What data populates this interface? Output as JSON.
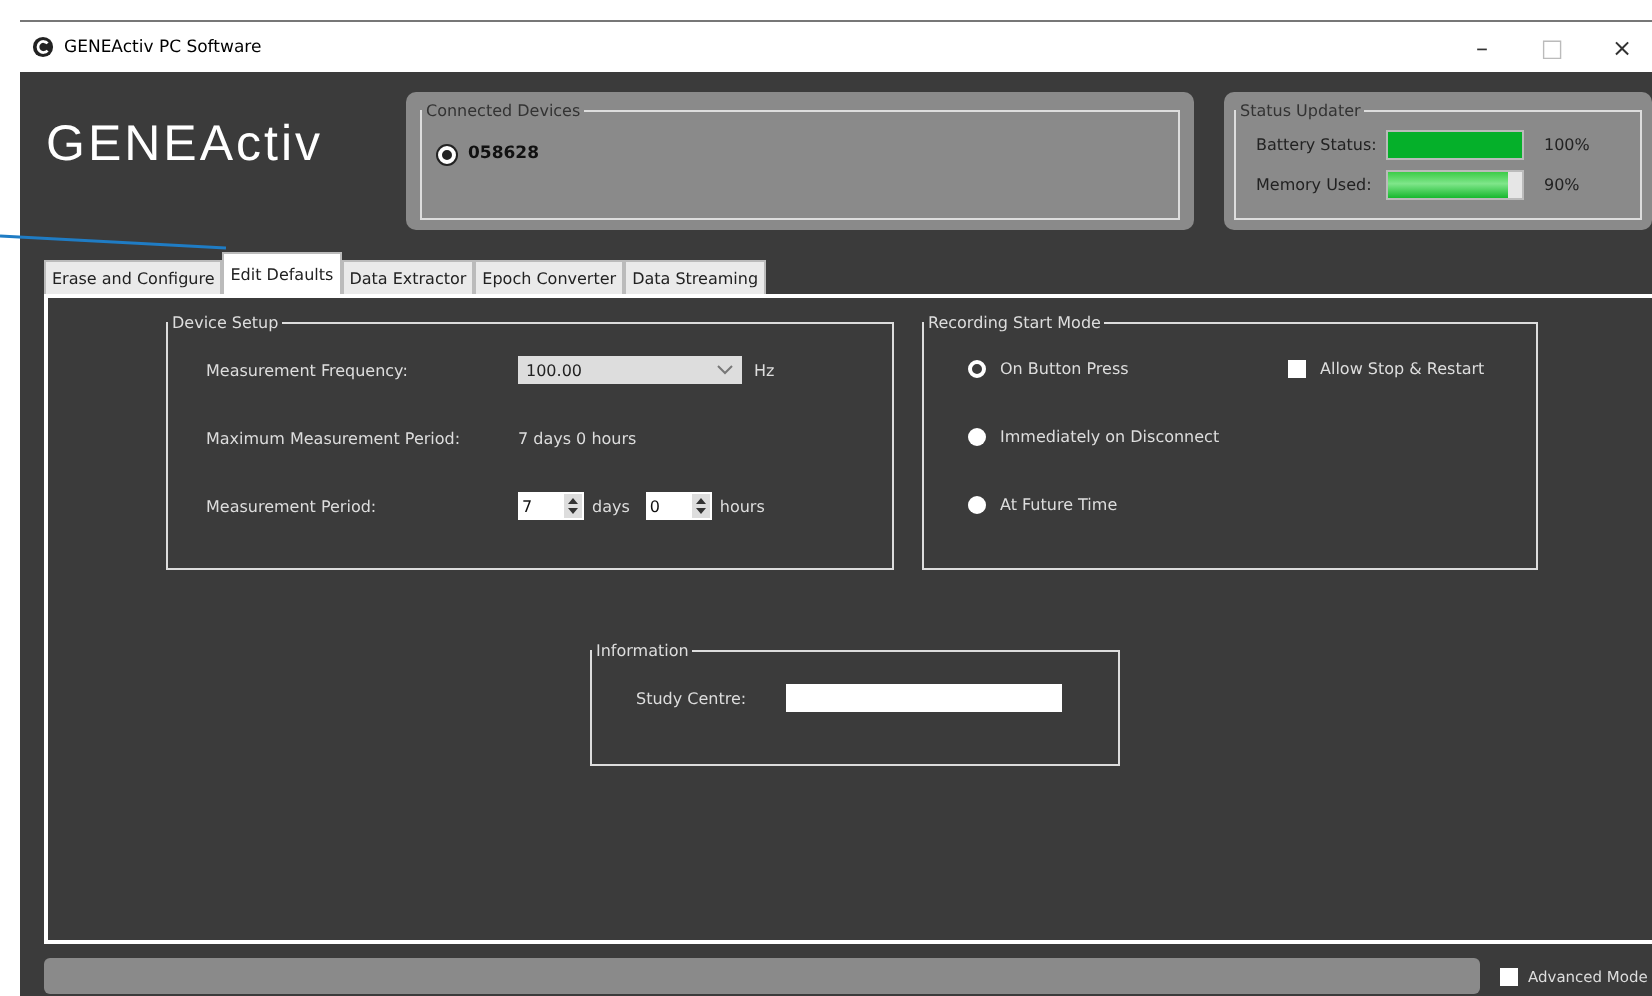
{
  "window": {
    "title": "GENEActiv PC Software",
    "controls": [
      "–",
      "□",
      "×"
    ]
  },
  "logo": "GENEActiv",
  "connected_devices": {
    "title": "Connected Devices",
    "devices": [
      {
        "label": "058628",
        "selected": true
      }
    ]
  },
  "status_updater": {
    "title": "Status Updater",
    "meters": [
      {
        "label": "Battery Status:",
        "kind": "solid",
        "level": 1.0,
        "reading": "100%"
      },
      {
        "label": "Memory Used:",
        "kind": "gradient",
        "level": 0.9,
        "reading": "90%"
      }
    ]
  },
  "tabs": [
    {
      "label": "Erase and Configure",
      "selected": false
    },
    {
      "label": "Edit Defaults",
      "selected": true
    },
    {
      "label": "Data Extractor",
      "selected": false
    },
    {
      "label": "Epoch Converter",
      "selected": false
    },
    {
      "label": "Data Streaming",
      "selected": false
    }
  ],
  "device_setup": {
    "title": "Device Setup",
    "frequency": {
      "label": "Measurement Frequency:",
      "value": "100.00",
      "unit": "Hz"
    },
    "max_period": {
      "label": "Maximum Measurement Period:",
      "value": "7 days 0 hours"
    },
    "period": {
      "label": "Measurement Period:",
      "days": "7",
      "days_unit": "days",
      "hours": "0",
      "hours_unit": "hours"
    }
  },
  "recording_start_mode": {
    "title": "Recording Start Mode",
    "options": [
      {
        "label": "On Button Press",
        "selected": true
      },
      {
        "label": "Immediately on Disconnect",
        "selected": false
      },
      {
        "label": "At Future Time",
        "selected": false
      }
    ],
    "allow_stop_restart": {
      "label": "Allow Stop & Restart",
      "checked": false
    }
  },
  "information": {
    "title": "Information",
    "study_centre": {
      "label": "Study Centre:"
    }
  },
  "advanced_mode": {
    "label": "Advanced Mode",
    "checked": false
  }
}
